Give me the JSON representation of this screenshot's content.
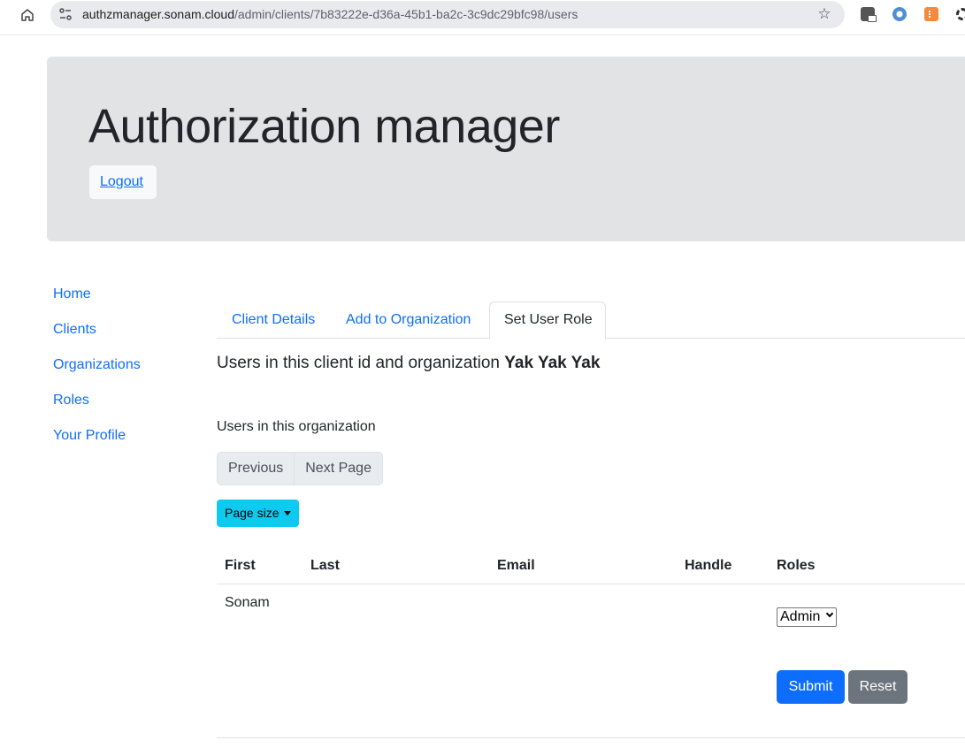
{
  "browser": {
    "url_host": "authzmanager.sonam.cloud",
    "url_path": "/admin/clients/7b83222e-d36a-45b1-ba2c-3c9dc29bfc98/users",
    "icons": [
      "home-icon",
      "site-info-icon",
      "bookmark-star-icon",
      "extension-icon",
      "extension-icon",
      "extension-icon",
      "extension-icon"
    ]
  },
  "header": {
    "title": "Authorization manager",
    "logout_label": "Logout"
  },
  "sidebar": {
    "items": [
      {
        "label": "Home"
      },
      {
        "label": "Clients"
      },
      {
        "label": "Organizations"
      },
      {
        "label": "Roles"
      },
      {
        "label": "Your Profile"
      }
    ]
  },
  "main": {
    "tabs": [
      {
        "label": "Client Details",
        "active": false
      },
      {
        "label": "Add to Organization",
        "active": false
      },
      {
        "label": "Set User Role",
        "active": true
      }
    ],
    "section_title_prefix": "Users in this client id and organization ",
    "organization_name": "Yak Yak Yak",
    "sub_label": "Users in this organization",
    "pager": {
      "previous_label": "Previous",
      "next_label": "Next Page"
    },
    "page_size_label": "Page size",
    "table": {
      "columns": [
        "First",
        "Last",
        "Email",
        "Handle",
        "Roles"
      ],
      "rows": [
        {
          "first": "Sonam",
          "last": "",
          "email": "",
          "handle": "",
          "role": "Admin"
        }
      ]
    },
    "submit_label": "Submit",
    "reset_label": "Reset"
  },
  "colors": {
    "primary": "#0d6efd",
    "info": "#0dcaf0",
    "secondary": "#6c757d",
    "jumbotron_bg": "#e2e3e5"
  }
}
